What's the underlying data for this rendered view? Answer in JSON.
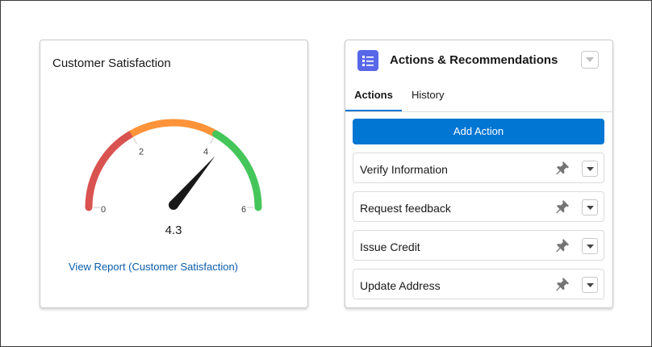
{
  "satisfaction": {
    "title": "Customer Satisfaction",
    "gauge": {
      "min": 0,
      "max": 6,
      "value": 4.3,
      "value_label": "4.3",
      "tick_labels": [
        "0",
        "2",
        "4",
        "6"
      ],
      "bands": [
        {
          "from": 0,
          "to": 2,
          "color": "#d95350"
        },
        {
          "from": 2,
          "to": 4,
          "color": "#fe9339"
        },
        {
          "from": 4,
          "to": 6,
          "color": "#45c65a"
        }
      ],
      "needle_color": "#181818"
    },
    "report_link": "View Report (Customer Satisfaction)"
  },
  "actions_panel": {
    "title": "Actions & Recommendations",
    "tabs": [
      {
        "label": "Actions",
        "active": true
      },
      {
        "label": "History",
        "active": false
      }
    ],
    "add_action_label": "Add Action",
    "items": [
      {
        "label": "Verify Information"
      },
      {
        "label": "Request feedback"
      },
      {
        "label": "Issue Credit"
      },
      {
        "label": "Update Address"
      }
    ],
    "colors": {
      "brand": "#0176d3",
      "icon_bg": "#5867e8"
    }
  }
}
